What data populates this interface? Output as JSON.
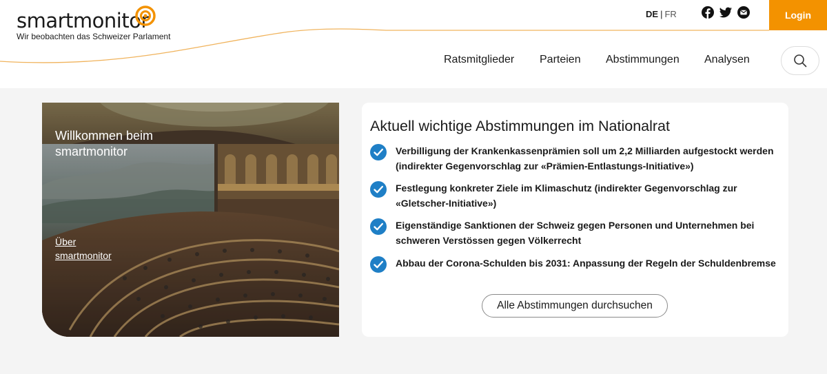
{
  "brand": {
    "name": "smartmonitor",
    "tagline": "Wir beobachten das Schweizer Parlament",
    "accent_color": "#f39200",
    "logo_icon": "magnifier-eye-logo"
  },
  "header": {
    "languages": {
      "active": "DE",
      "separator": "|",
      "other": "FR"
    },
    "social": [
      "facebook-icon",
      "twitter-icon",
      "mail-icon"
    ],
    "login_label": "Login"
  },
  "nav": {
    "items": [
      {
        "label": "Ratsmitglieder"
      },
      {
        "label": "Parteien"
      },
      {
        "label": "Abstimmungen"
      },
      {
        "label": "Analysen"
      }
    ],
    "search_icon": "search-icon"
  },
  "hero": {
    "title": "Willkommen beim smartmonitor",
    "link": "Über smartmonitor"
  },
  "votes": {
    "title": "Aktuell wichtige Abstimmungen im Nationalrat",
    "check_color": "#1f7fc6",
    "items": [
      {
        "text": "Verbilligung der Krankenkassenprämien soll um 2,2 Milliarden aufgestockt werden (indirekter Gegenvorschlag zur «Prämien-Entlastungs-Initiative»)"
      },
      {
        "text": "Festlegung konkreter Ziele im Klimaschutz (indirekter Gegenvorschlag zur «Gletscher-Initiative»)"
      },
      {
        "text": "Eigenständige Sanktionen der Schweiz gegen Personen und Unternehmen bei schweren Verstössen gegen Völkerrecht"
      },
      {
        "text": "Abbau der Corona-Schulden bis 2031: Anpassung der Regeln der Schuldenbremse"
      }
    ],
    "button_label": "Alle Abstimmungen durchsuchen"
  }
}
